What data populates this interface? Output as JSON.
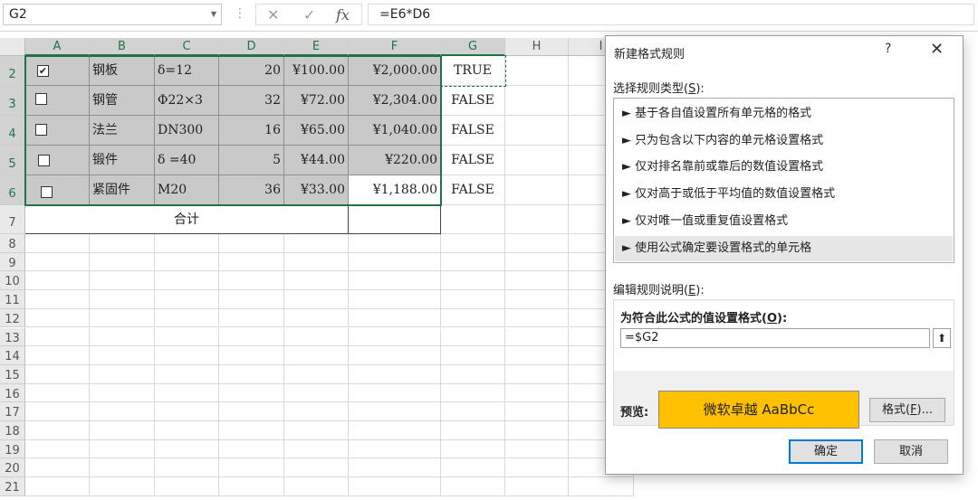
{
  "formula_bar": {
    "name_box": "G2",
    "dots": "⋮",
    "cancel_glyph": "✕",
    "enter_glyph": "✓",
    "fx_glyph": "fx",
    "formula": "=E6*D6"
  },
  "sheet": {
    "columns": [
      "A",
      "B",
      "C",
      "D",
      "E",
      "F",
      "G",
      "H",
      "I"
    ],
    "rows": [
      "2",
      "3",
      "4",
      "5",
      "6",
      "7",
      "8",
      "9",
      "10",
      "11",
      "12",
      "13",
      "14",
      "15",
      "16",
      "17",
      "18",
      "19",
      "20",
      "21"
    ],
    "data_rows": [
      {
        "checked": true,
        "name": "钢板",
        "spec": "δ=12",
        "qty": "20",
        "price": "¥100.00",
        "total": "¥2,000.00",
        "flag": "TRUE"
      },
      {
        "checked": false,
        "name": "钢管",
        "spec": "Φ22×3",
        "qty": "32",
        "price": "¥72.00",
        "total": "¥2,304.00",
        "flag": "FALSE"
      },
      {
        "checked": false,
        "name": "法兰",
        "spec": "DN300",
        "qty": "16",
        "price": "¥65.00",
        "total": "¥1,040.00",
        "flag": "FALSE"
      },
      {
        "checked": false,
        "name": "锻件",
        "spec": "δ =40",
        "qty": "5",
        "price": "¥44.00",
        "total": "¥220.00",
        "flag": "FALSE"
      },
      {
        "checked": false,
        "name": "紧固件",
        "spec": "M20",
        "qty": "36",
        "price": "¥33.00",
        "total": "¥1,188.00",
        "flag": "FALSE"
      }
    ],
    "total_label": "合计",
    "check_mark": "✔"
  },
  "dialog": {
    "title": "新建格式规则",
    "help": "?",
    "close": "✕",
    "rule_type_label": "选择规则类型(",
    "rule_type_key": "S",
    "rule_type_suffix": "):",
    "rule_types": [
      "► 基于各自值设置所有单元格的格式",
      "► 只为包含以下内容的单元格设置格式",
      "► 仅对排名靠前或靠后的数值设置格式",
      "► 仅对高于或低于平均值的数值设置格式",
      "► 仅对唯一值或重复值设置格式",
      "► 使用公式确定要设置格式的单元格"
    ],
    "edit_label": "编辑规则说明(",
    "edit_key": "E",
    "edit_suffix": "):",
    "formula_label": "为符合此公式的值设置格式(",
    "formula_key": "O",
    "formula_suffix": "):",
    "formula_value": "=$G2",
    "collapse_glyph": "⬆",
    "preview_label": "预览:",
    "preview_text": "微软卓越  AaBbCc",
    "format_button": "格式(",
    "format_key": "F",
    "format_suffix": ")...",
    "ok": "确定",
    "cancel": "取消",
    "colors": {
      "preview_fill": "#ffc000",
      "grid_selection": "#217346",
      "ok_border": "#0078d7"
    }
  }
}
